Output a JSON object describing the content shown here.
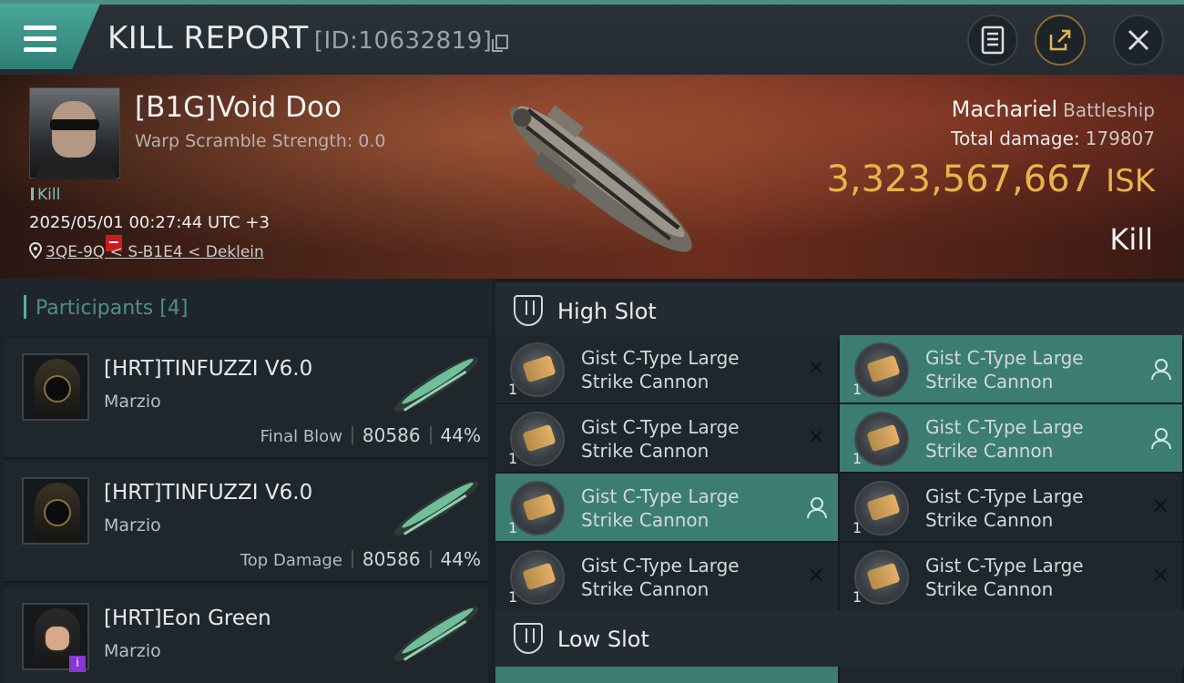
{
  "header": {
    "title": "KILL REPORT",
    "report_id": "[ID:10632819]"
  },
  "victim": {
    "pilot": "[B1G]Void Doo",
    "warp_scramble": "Warp Scramble Strength: 0.0",
    "tag": "Kill",
    "datetime": "2025/05/01 00:27:44 UTC +3",
    "location": "3QE-9Q < S-B1E4 < Deklein",
    "ship_name": "Machariel",
    "ship_class": "Battleship",
    "total_damage_label": "Total damage:",
    "total_damage_value": "179807",
    "isk_value": "3,323,567,667",
    "isk_unit": "ISK",
    "result": "Kill"
  },
  "participants": {
    "title": "Participants",
    "count": "[4]",
    "rows": [
      {
        "name": "[HRT]TINFUZZI V6.0",
        "corp": "Marzio",
        "stat_label": "Final Blow",
        "damage": "80586",
        "percent": "44%"
      },
      {
        "name": "[HRT]TINFUZZI V6.0",
        "corp": "Marzio",
        "stat_label": "Top Damage",
        "damage": "80586",
        "percent": "44%"
      },
      {
        "name": "[HRT]Eon Green",
        "corp": "Marzio",
        "badge": "i"
      }
    ]
  },
  "high_slot": {
    "label": "High Slot",
    "modules": [
      {
        "name": "Gist C-Type Large Strike Cannon",
        "qty": "1",
        "state": "destroyed",
        "glyph": "✕"
      },
      {
        "name": "Gist C-Type Large Strike Cannon",
        "qty": "1",
        "state": "dropped",
        "glyph": ""
      },
      {
        "name": "Gist C-Type Large Strike Cannon",
        "qty": "1",
        "state": "destroyed",
        "glyph": "✕"
      },
      {
        "name": "Gist C-Type Large Strike Cannon",
        "qty": "1",
        "state": "dropped",
        "glyph": ""
      },
      {
        "name": "Gist C-Type Large Strike Cannon",
        "qty": "1",
        "state": "dropped",
        "glyph": ""
      },
      {
        "name": "Gist C-Type Large Strike Cannon",
        "qty": "1",
        "state": "destroyed",
        "glyph": "✕"
      },
      {
        "name": "Gist C-Type Large Strike Cannon",
        "qty": "1",
        "state": "destroyed",
        "glyph": "✕"
      },
      {
        "name": "Gist C-Type Large Strike Cannon",
        "qty": "1",
        "state": "destroyed",
        "glyph": "✕"
      }
    ]
  },
  "low_slot": {
    "label": "Low Slot"
  },
  "colors": {
    "accent": "#4aa79a",
    "fitted": "#3c7d73",
    "isk": "#e8b44a"
  }
}
